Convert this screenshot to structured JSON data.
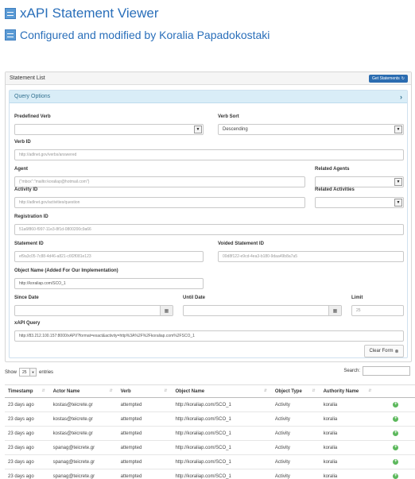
{
  "header": {
    "title": "xAPI Statement Viewer",
    "subtitle": "Configured and modified by Koralia Papadokostaki"
  },
  "statement_panel": {
    "title": "Statement List",
    "get_button": "Get Statements",
    "get_icon": "refresh-icon"
  },
  "query": {
    "title": "Query Options",
    "predefined_verb": {
      "label": "Predefined Verb",
      "value": ""
    },
    "verb_sort": {
      "label": "Verb Sort",
      "value": "Descending"
    },
    "verb_id": {
      "label": "Verb ID",
      "placeholder": "http://adlnet.gov/verbs/answered"
    },
    "agent": {
      "label": "Agent",
      "placeholder": "{\"mbox\":\"mailto:koraliap@hotmail.com\"}"
    },
    "related_agents": {
      "label": "Related Agents",
      "value": ""
    },
    "activity_id": {
      "label": "Activity ID",
      "placeholder": "http://adlnet.gov/activities/question"
    },
    "related_activities": {
      "label": "Related Activities",
      "value": ""
    },
    "registration_id": {
      "label": "Registration ID",
      "placeholder": "51a6f860-f997-11e3-8f1d-0800200c9a66"
    },
    "statement_id": {
      "label": "Statement ID",
      "placeholder": "ef9a3c05-7c88-4d46-a821-c6f2f081e123"
    },
    "voided_statement_id": {
      "label": "Voided Statement ID",
      "placeholder": "00d8f122-e9cd-4ea3-b180-9daa49b8a7a5"
    },
    "object_name": {
      "label": "Object Name (Added For Our Implementation)",
      "value": "http://koraliap.com/SCO_1"
    },
    "since_date": {
      "label": "Since Date",
      "value": ""
    },
    "until_date": {
      "label": "Until Date",
      "value": ""
    },
    "limit": {
      "label": "Limit",
      "placeholder": "25"
    },
    "xapi_query": {
      "label": "xAPI Query",
      "value": "http://83.212.100.157:8000/xAPI/?format=exact&activity=http%3A%2F%2Fkoraliap.com%2FSCO_1"
    },
    "clear_button": "Clear Form"
  },
  "table": {
    "show_label": "Show",
    "entries_value": "25",
    "entries_label": "entries",
    "search_label": "Search:",
    "columns": [
      "Timestamp",
      "Actor Name",
      "Verb",
      "Object Name",
      "Object Type",
      "Authority Name",
      ""
    ],
    "rows": [
      [
        "23 days ago",
        "kostas@teicrete.gr",
        "attempted",
        "http://koraliap.com/SCO_1",
        "Activity",
        "koralia"
      ],
      [
        "23 days ago",
        "kostas@teicrete.gr",
        "attempted",
        "http://koraliap.com/SCO_1",
        "Activity",
        "koralia"
      ],
      [
        "23 days ago",
        "kostas@teicrete.gr",
        "attempted",
        "http://koraliap.com/SCO_1",
        "Activity",
        "koralia"
      ],
      [
        "23 days ago",
        "spanag@teicrete.gr",
        "attempted",
        "http://koraliap.com/SCO_1",
        "Activity",
        "koralia"
      ],
      [
        "23 days ago",
        "spanag@teicrete.gr",
        "attempted",
        "http://koraliap.com/SCO_1",
        "Activity",
        "koralia"
      ],
      [
        "23 days ago",
        "spanag@teicrete.gr",
        "attempted",
        "http://koraliap.com/SCO_1",
        "Activity",
        "koralia"
      ]
    ]
  }
}
